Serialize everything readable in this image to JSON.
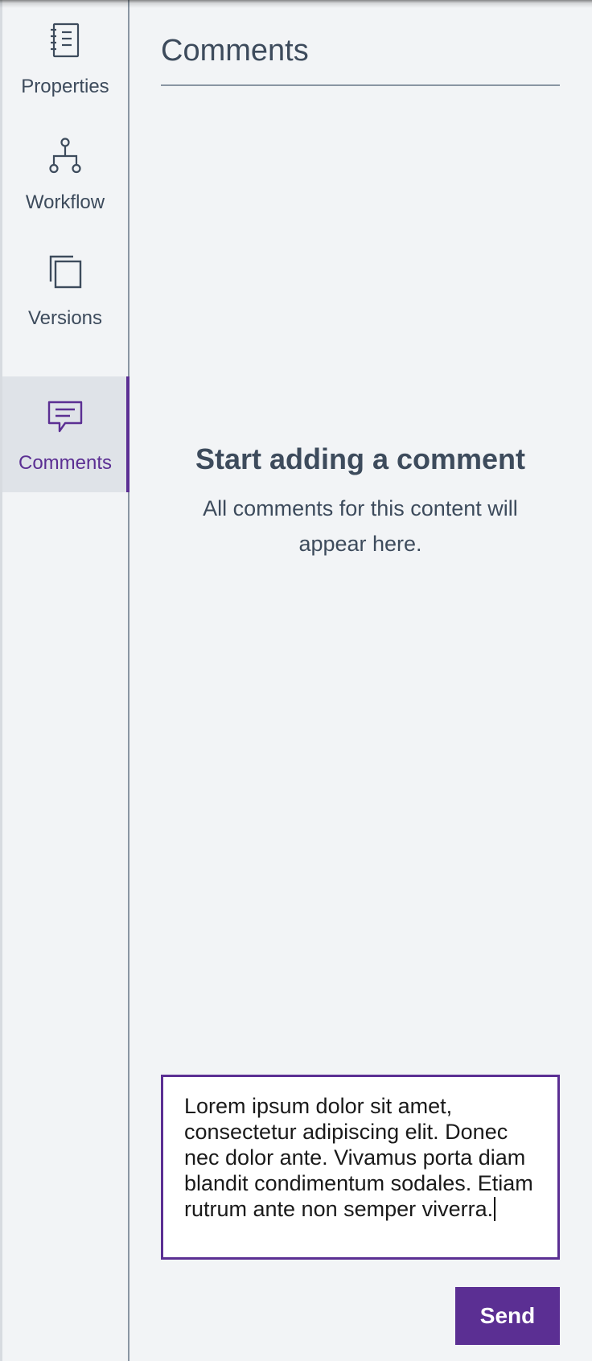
{
  "sidebar": {
    "items": [
      {
        "label": "Properties",
        "icon": "properties-icon"
      },
      {
        "label": "Workflow",
        "icon": "workflow-icon"
      },
      {
        "label": "Versions",
        "icon": "versions-icon"
      },
      {
        "label": "Comments",
        "icon": "comments-icon",
        "active": true
      }
    ]
  },
  "main": {
    "title": "Comments",
    "empty_state": {
      "heading": "Start adding a comment",
      "text": "All comments for this content will appear here."
    },
    "comment_input": {
      "value": "Lorem ipsum dolor sit amet, consectetur adipiscing elit. Donec nec dolor ante. Vivamus porta diam blandit condimentum sodales. Etiam rutrum ante non semper viverra."
    },
    "send_label": "Send"
  },
  "colors": {
    "accent": "#5b2f93",
    "text": "#3d4b5c",
    "background": "#f2f4f6",
    "active_background": "#dfe3e8"
  }
}
